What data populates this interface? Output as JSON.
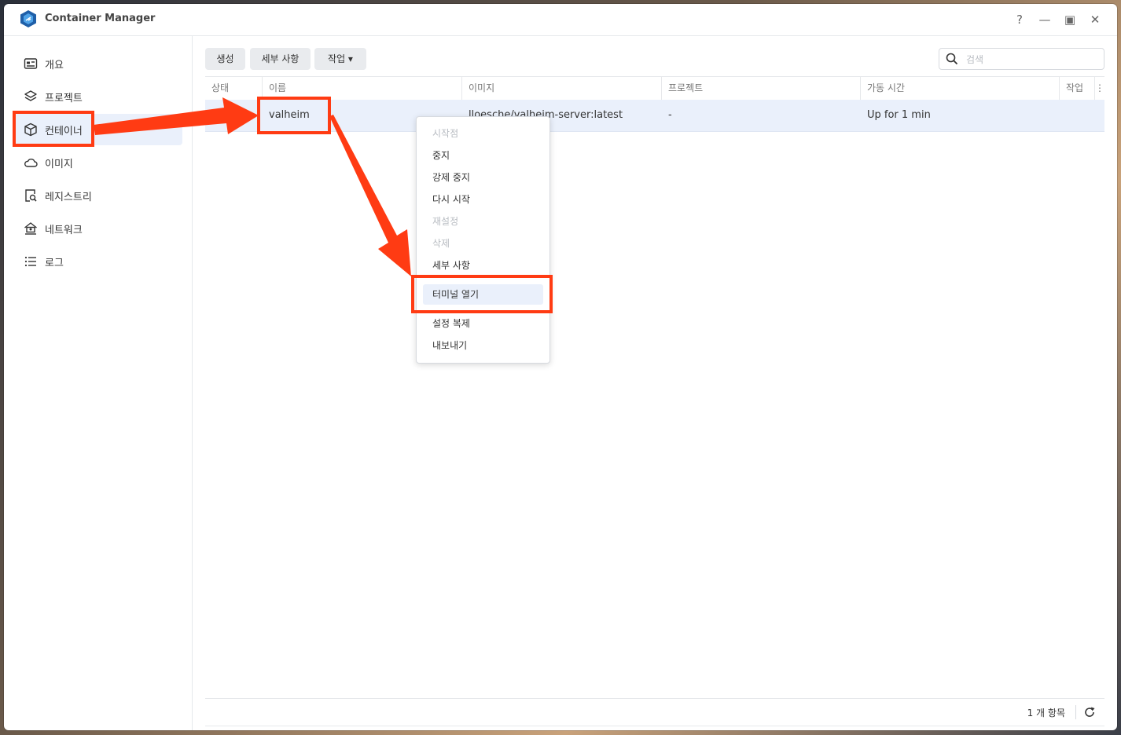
{
  "window": {
    "title": "Container Manager",
    "help_label": "?",
    "minimize_label": "—",
    "maximize_label": "▣",
    "close_label": "✕"
  },
  "sidebar": {
    "items": [
      {
        "label": "개요",
        "icon": "overview-icon",
        "active": false
      },
      {
        "label": "프로젝트",
        "icon": "layers-icon",
        "active": false
      },
      {
        "label": "컨테이너",
        "icon": "cube-icon",
        "active": true
      },
      {
        "label": "이미지",
        "icon": "cloud-icon",
        "active": false
      },
      {
        "label": "레지스트리",
        "icon": "registry-search-icon",
        "active": false
      },
      {
        "label": "네트워크",
        "icon": "network-house-icon",
        "active": false
      },
      {
        "label": "로그",
        "icon": "list-icon",
        "active": false
      }
    ]
  },
  "toolbar": {
    "create_label": "생성",
    "details_label": "세부 사항",
    "action_label": "작업 ▾"
  },
  "search": {
    "placeholder": "검색",
    "value": ""
  },
  "table": {
    "headers": [
      "상태",
      "이름",
      "이미지",
      "프로젝트",
      "가동 시간",
      "작업"
    ],
    "more_label": "⋮",
    "rows": [
      {
        "status": "",
        "name": "valheim",
        "image": "lloesche/valheim-server:latest",
        "project": "-",
        "uptime": "Up for 1 min"
      }
    ]
  },
  "footer": {
    "item_count": "1 개 항목"
  },
  "context_menu": {
    "items": [
      {
        "label": "시작점",
        "disabled": true
      },
      {
        "label": "중지",
        "disabled": false
      },
      {
        "label": "강제 중지",
        "disabled": false
      },
      {
        "label": "다시 시작",
        "disabled": false
      },
      {
        "label": "재설정",
        "disabled": true
      },
      {
        "label": "삭제",
        "disabled": true
      },
      {
        "label": "세부 사항",
        "disabled": false
      },
      {
        "label": "터미널 열기",
        "disabled": false,
        "hover": true
      },
      {
        "label": "설정 복제",
        "disabled": false
      },
      {
        "label": "내보내기",
        "disabled": false
      }
    ]
  },
  "colors": {
    "accent_selection": "#eaf0fb",
    "annotation_red": "#ff3b13",
    "brand_blue": "#1f5fa8"
  }
}
